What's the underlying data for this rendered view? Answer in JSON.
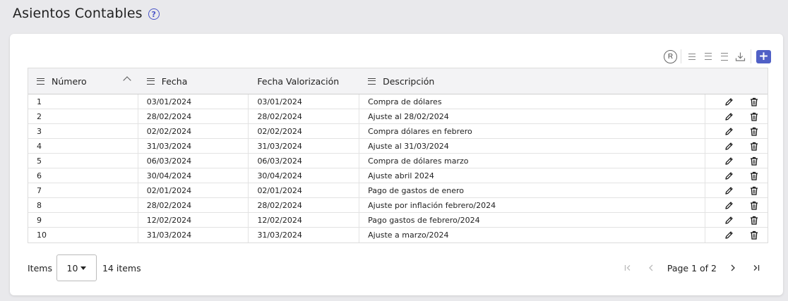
{
  "page": {
    "title": "Asientos Contables",
    "help_icon": "?"
  },
  "toolbar": {
    "reset_label": "R",
    "icons": [
      "reset-columns-icon",
      "density-compact-icon",
      "density-normal-icon",
      "density-comfortable-icon",
      "download-icon",
      "add-icon"
    ],
    "add_label": "+"
  },
  "grid": {
    "columns": [
      "Número",
      "Fecha",
      "Fecha Valorización",
      "Descripción"
    ],
    "rows": [
      {
        "numero": "1",
        "fecha": "03/01/2024",
        "valorizacion": "03/01/2024",
        "descripcion": "Compra de dólares"
      },
      {
        "numero": "2",
        "fecha": "28/02/2024",
        "valorizacion": "28/02/2024",
        "descripcion": "Ajuste al 28/02/2024"
      },
      {
        "numero": "3",
        "fecha": "02/02/2024",
        "valorizacion": "02/02/2024",
        "descripcion": "Compra dólares en febrero"
      },
      {
        "numero": "4",
        "fecha": "31/03/2024",
        "valorizacion": "31/03/2024",
        "descripcion": "Ajuste al 31/03/2024"
      },
      {
        "numero": "5",
        "fecha": "06/03/2024",
        "valorizacion": "06/03/2024",
        "descripcion": "Compra de dólares marzo"
      },
      {
        "numero": "6",
        "fecha": "30/04/2024",
        "valorizacion": "30/04/2024",
        "descripcion": "Ajuste abril 2024"
      },
      {
        "numero": "7",
        "fecha": "02/01/2024",
        "valorizacion": "02/01/2024",
        "descripcion": "Pago de gastos de enero"
      },
      {
        "numero": "8",
        "fecha": "28/02/2024",
        "valorizacion": "28/02/2024",
        "descripcion": "Ajuste por inflación febrero/2024"
      },
      {
        "numero": "9",
        "fecha": "12/02/2024",
        "valorizacion": "12/02/2024",
        "descripcion": "Pago gastos de febrero/2024"
      },
      {
        "numero": "10",
        "fecha": "31/03/2024",
        "valorizacion": "31/03/2024",
        "descripcion": "Ajuste a marzo/2024"
      }
    ]
  },
  "footer": {
    "items_label": "Items",
    "page_size": "10",
    "items_count": "14 items",
    "page_label": "Page 1 of 2"
  },
  "colors": {
    "accent": "#5060c6",
    "help": "#4a55c8"
  }
}
